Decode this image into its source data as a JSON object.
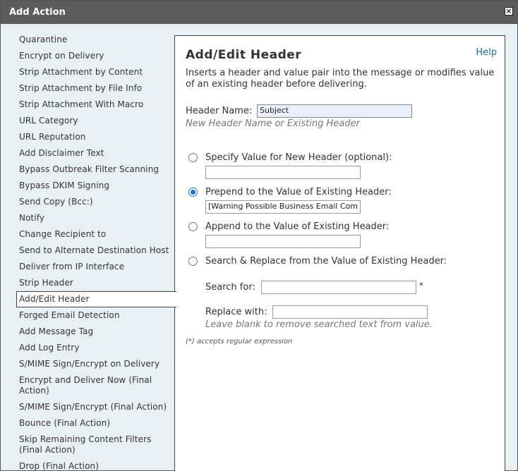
{
  "dialog": {
    "title": "Add Action",
    "close_glyph": "×"
  },
  "sidebar": {
    "items": [
      {
        "label": "Quarantine"
      },
      {
        "label": "Encrypt on Delivery"
      },
      {
        "label": "Strip Attachment by Content"
      },
      {
        "label": "Strip Attachment by File Info"
      },
      {
        "label": "Strip Attachment With Macro"
      },
      {
        "label": "URL Category"
      },
      {
        "label": "URL Reputation"
      },
      {
        "label": "Add Disclaimer Text"
      },
      {
        "label": "Bypass Outbreak Filter Scanning"
      },
      {
        "label": "Bypass DKIM Signing"
      },
      {
        "label": "Send Copy (Bcc:)"
      },
      {
        "label": "Notify"
      },
      {
        "label": "Change Recipient to"
      },
      {
        "label": "Send to Alternate Destination Host"
      },
      {
        "label": "Deliver from IP Interface"
      },
      {
        "label": "Strip Header"
      },
      {
        "label": "Add/Edit Header",
        "selected": true
      },
      {
        "label": "Forged Email Detection"
      },
      {
        "label": "Add Message Tag"
      },
      {
        "label": "Add Log Entry"
      },
      {
        "label": "S/MIME Sign/Encrypt on Delivery"
      },
      {
        "label": "Encrypt and Deliver Now (Final Action)"
      },
      {
        "label": "S/MIME Sign/Encrypt (Final Action)"
      },
      {
        "label": "Bounce (Final Action)"
      },
      {
        "label": "Skip Remaining Content Filters (Final Action)"
      },
      {
        "label": "Drop (Final Action)"
      }
    ]
  },
  "panel": {
    "title": "Add/Edit Header",
    "help": "Help",
    "description": "Inserts a header and value pair into the message or modifies value of an existing header before delivering.",
    "header_name_label": "Header Name:",
    "header_name_value": "Subject",
    "header_name_hint": "New Header Name or Existing Header",
    "options": {
      "specify": {
        "label": "Specify Value for New Header (optional):",
        "value": "",
        "checked": false
      },
      "prepend": {
        "label": "Prepend to the Value of Existing Header:",
        "value": "[Warning Possible Business Email Com",
        "checked": true
      },
      "append": {
        "label": "Append to the Value of Existing Header:",
        "value": "",
        "checked": false
      },
      "search_replace": {
        "label": "Search & Replace from the Value of Existing Header:",
        "checked": false
      }
    },
    "search_for_label": "Search for:",
    "search_for_value": "",
    "search_asterisk": "*",
    "replace_with_label": "Replace with:",
    "replace_with_value": "",
    "replace_hint": "Leave blank to remove searched text from value.",
    "regex_note": "(*) accepts regular expression"
  }
}
